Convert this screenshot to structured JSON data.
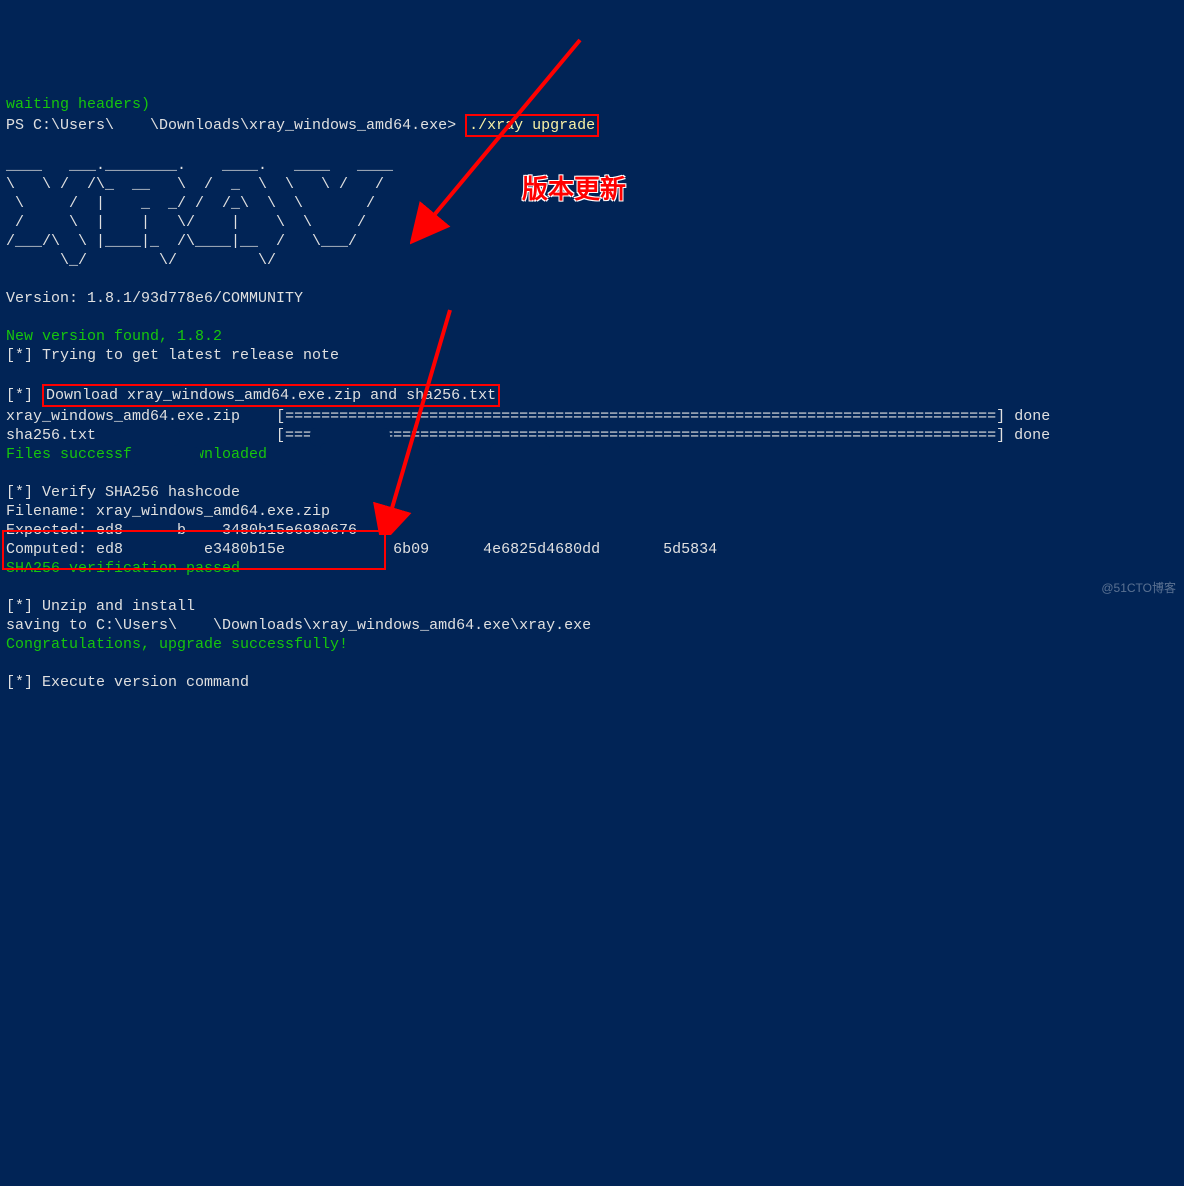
{
  "header_line_partial": "waiting headers)",
  "prompt_prefix": "PS C:\\Users\\    \\Downloads\\xray_windows_amd64.exe>",
  "command": "./xray upgrade",
  "ascii_art": [
    "____   ___.________.    ____.   ____   ____",
    "\\   \\ /  /\\_  __   \\  /  _  \\  \\   \\ /   /",
    " \\     /  |    _  _/ /  /_\\  \\  \\       /",
    " /     \\  |    |   \\/    |    \\  \\     /",
    "/___/\\  \\ |____|_  /\\____|__  /   \\___/",
    "      \\_/        \\/         \\/"
  ],
  "version_line": "Version: 1.8.1/93d778e6/COMMUNITY",
  "new_version": "New version found, 1.8.2",
  "trying_line": "[*] Trying to get latest release note",
  "download_prefix": "[*] ",
  "download_text": "Download xray_windows_amd64.exe.zip and sha256.txt",
  "progress1_file": "xray_windows_amd64.exe.zip",
  "progress_bar": "[===============================================================================]",
  "progress_done": " done",
  "progress2_file": "sha256.txt",
  "files_downloaded": "Files successfully downloaded",
  "verify_line": "[*] Verify SHA256 hashcode",
  "filename_line": "Filename: xray_windows_amd64.exe.zip",
  "expected_line": "Expected: ed8      b    3480b15e6980676",
  "computed_line": "Computed: ed8         e3480b15e            6b09      4e6825d4680dd       5d5834",
  "sha_passed": "SHA256 verification passed",
  "unzip_line": "[*] Unzip and install",
  "saving_line": "saving to C:\\Users\\    \\Downloads\\xray_windows_amd64.exe\\xray.exe",
  "congrats": "Congratulations, upgrade successfully!",
  "exec_line": "[*] Execute version command",
  "annotation_label": "版本更新",
  "watermark": "@51CTO博客"
}
